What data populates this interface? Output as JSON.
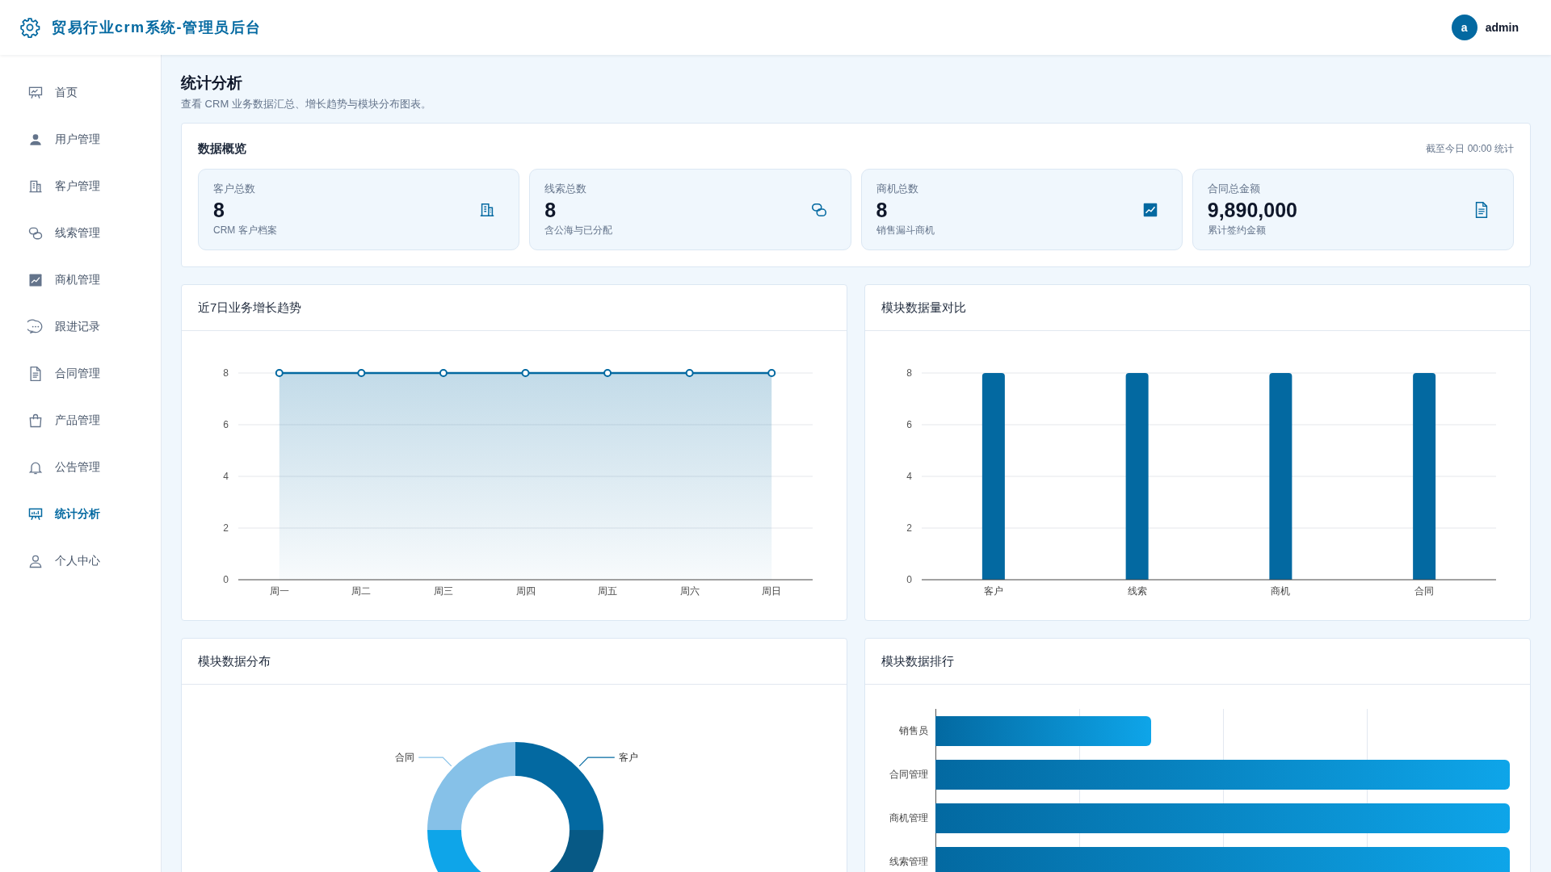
{
  "header": {
    "title": "贸易行业crm系统-管理员后台",
    "user": {
      "avatar_letter": "a",
      "name": "admin"
    }
  },
  "sidebar": {
    "items": [
      {
        "label": "首页",
        "selected": false
      },
      {
        "label": "用户管理",
        "selected": false
      },
      {
        "label": "客户管理",
        "selected": false
      },
      {
        "label": "线索管理",
        "selected": false
      },
      {
        "label": "商机管理",
        "selected": false
      },
      {
        "label": "跟进记录",
        "selected": false
      },
      {
        "label": "合同管理",
        "selected": false
      },
      {
        "label": "产品管理",
        "selected": false
      },
      {
        "label": "公告管理",
        "selected": false
      },
      {
        "label": "统计分析",
        "selected": true
      },
      {
        "label": "个人中心",
        "selected": false
      }
    ]
  },
  "page": {
    "title": "统计分析",
    "subtitle": "查看 CRM 业务数据汇总、增长趋势与模块分布图表。"
  },
  "overview": {
    "title": "数据概览",
    "note": "截至今日 00:00 统计",
    "stats": [
      {
        "label": "客户总数",
        "value": "8",
        "caption": "CRM 客户档案"
      },
      {
        "label": "线索总数",
        "value": "8",
        "caption": "含公海与已分配"
      },
      {
        "label": "商机总数",
        "value": "8",
        "caption": "销售漏斗商机"
      },
      {
        "label": "合同总金额",
        "value": "9,890,000",
        "caption": "累计签约金额"
      }
    ]
  },
  "trend_panel": {
    "title": "近7日业务增长趋势",
    "chart_data": {
      "type": "area",
      "categories": [
        "周一",
        "周二",
        "周三",
        "周四",
        "周五",
        "周六",
        "周日"
      ],
      "values": [
        8,
        8,
        8,
        8,
        8,
        8,
        8
      ],
      "grid": true,
      "ylim": [
        0,
        8
      ],
      "yticks": [
        0,
        2,
        4,
        6,
        8
      ]
    }
  },
  "module_panel": {
    "title": "模块数据量对比",
    "chart_data": {
      "type": "bar",
      "categories": [
        "客户",
        "线索",
        "商机",
        "合同"
      ],
      "values": [
        8,
        8,
        8,
        8
      ],
      "grid": true,
      "ylim": [
        0,
        8
      ],
      "yticks": [
        0,
        2,
        4,
        6,
        8
      ]
    }
  },
  "distribution_panel": {
    "title": "模块数据分布",
    "slice_labels": [
      "合同",
      "客户"
    ]
  },
  "ranking_panel": {
    "title": "模块数据排行",
    "rows": [
      {
        "label": "销售员",
        "level": 0.375
      },
      {
        "label": "合同管理",
        "level": 1
      },
      {
        "label": "商机管理",
        "level": 1
      },
      {
        "label": "线索管理",
        "level": 1
      }
    ]
  }
}
